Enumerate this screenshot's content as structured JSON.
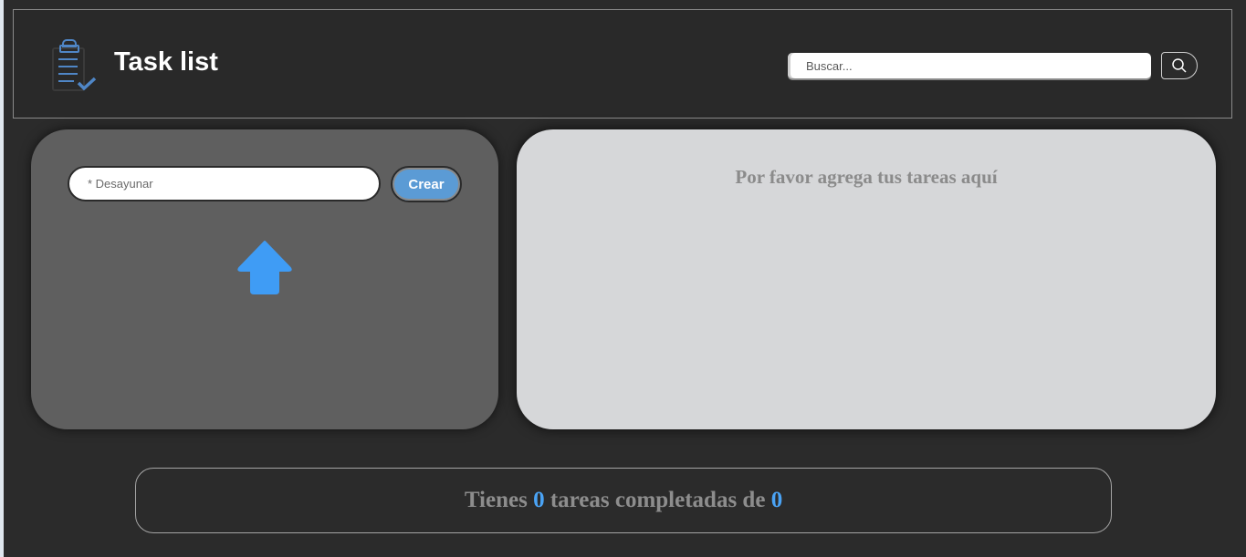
{
  "header": {
    "title": "Task list",
    "search_placeholder": "Buscar..."
  },
  "icons": {
    "logo": "clipboard-check-icon",
    "search": "search-icon",
    "arrow": "arrow-up-icon"
  },
  "form": {
    "task_placeholder": "* Desayunar",
    "create_label": "Crear"
  },
  "task_list": {
    "empty_message": "Por favor agrega tus tareas aquí"
  },
  "counter": {
    "prefix": "Tienes",
    "completed": "0",
    "middle": "tareas completadas de",
    "total": "0"
  },
  "colors": {
    "accent": "#5b9bd5",
    "count": "#4aa3f5",
    "background": "#2b2b2b",
    "left_card": "#5f5f5f",
    "right_card": "#d6d7d9"
  }
}
